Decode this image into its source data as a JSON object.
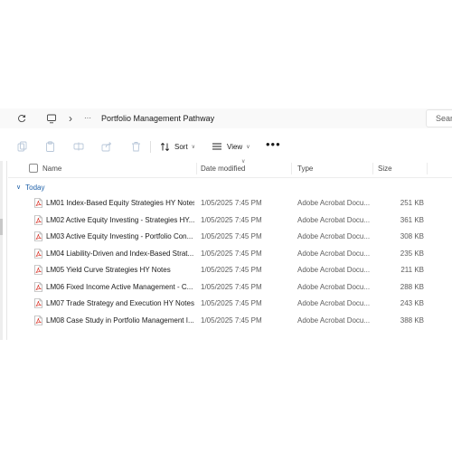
{
  "address_bar": {
    "path_label": "Portfolio Management Pathway",
    "ellipsis": "···",
    "chevron": "›",
    "search_placeholder": "Sear"
  },
  "toolbar": {
    "sort_label": "Sort",
    "view_label": "View",
    "more_label": "•••"
  },
  "columns": {
    "name": "Name",
    "date_modified": "Date modified",
    "type": "Type",
    "size": "Size"
  },
  "group": {
    "label": "Today",
    "arrow": "∨"
  },
  "files": [
    {
      "name": "LM01 Index-Based Equity Strategies HY Notes",
      "date": "1/05/2025 7:45 PM",
      "type": "Adobe Acrobat Docu...",
      "size": "251 KB"
    },
    {
      "name": "LM02 Active Equity Investing - Strategies HY...",
      "date": "1/05/2025 7:45 PM",
      "type": "Adobe Acrobat Docu...",
      "size": "361 KB"
    },
    {
      "name": "LM03 Active Equity Investing - Portfolio Con...",
      "date": "1/05/2025 7:45 PM",
      "type": "Adobe Acrobat Docu...",
      "size": "308 KB"
    },
    {
      "name": "LM04 Liability-Driven and Index-Based Strat...",
      "date": "1/05/2025 7:45 PM",
      "type": "Adobe Acrobat Docu...",
      "size": "235 KB"
    },
    {
      "name": "LM05 Yield Curve Strategies HY Notes",
      "date": "1/05/2025 7:45 PM",
      "type": "Adobe Acrobat Docu...",
      "size": "211 KB"
    },
    {
      "name": "LM06 Fixed Income Active Management - C...",
      "date": "1/05/2025 7:45 PM",
      "type": "Adobe Acrobat Docu...",
      "size": "288 KB"
    },
    {
      "name": "LM07 Trade Strategy and Execution HY Notes",
      "date": "1/05/2025 7:45 PM",
      "type": "Adobe Acrobat Docu...",
      "size": "243 KB"
    },
    {
      "name": "LM08 Case Study in Portfolio Management I...",
      "date": "1/05/2025 7:45 PM",
      "type": "Adobe Acrobat Docu...",
      "size": "388 KB"
    }
  ],
  "colors": {
    "accent": "#1d5fa8",
    "pdf_red": "#d93025",
    "disabled_icon": "#b8c7d9"
  }
}
